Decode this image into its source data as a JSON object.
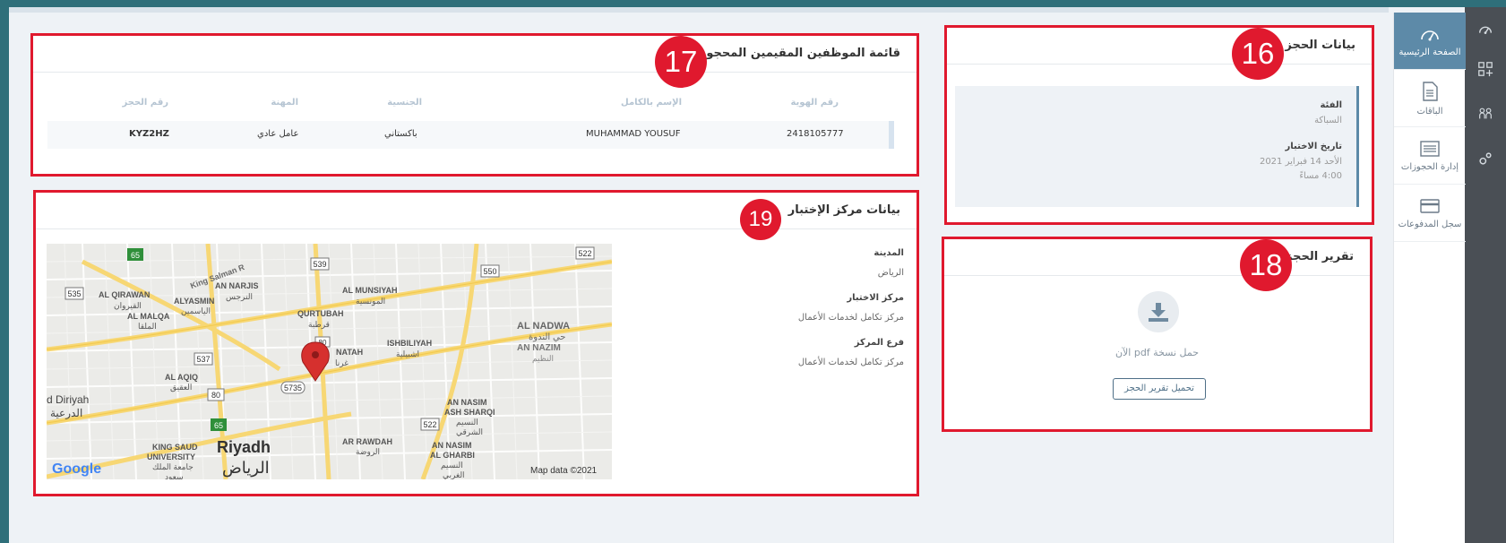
{
  "sidebar": {
    "items": [
      {
        "label": "الصفحة الرئيسية",
        "icon": "dashboard-icon",
        "active": true
      },
      {
        "label": "الباقات",
        "icon": "document-icon",
        "active": false
      },
      {
        "label": "إدارة الحجوزات",
        "icon": "list-icon",
        "active": false
      },
      {
        "label": "سجل المدفوعات",
        "icon": "card-icon",
        "active": false
      }
    ]
  },
  "rail": {
    "icons": [
      "speedometer-icon",
      "apps-add-icon",
      "people-icon",
      "settings-icon"
    ]
  },
  "booking_details": {
    "badge": "16",
    "title": "بيانات الحجز",
    "category_label": "الفئة",
    "category_value": "السباكة",
    "test_date_label": "تاريخ الاختبار",
    "test_date_value": "الأحد 14 فبراير 2021",
    "test_time_value": "4:00 مساءً"
  },
  "employees": {
    "badge": "17",
    "title": "قائمة الموظفين المقيمين المحجوز لهم",
    "columns": {
      "id": "رقم الهوية",
      "name": "الإسم بالكامل",
      "nationality": "الجنسية",
      "profession": "المهنة",
      "booking": "رقم الحجز"
    },
    "rows": [
      {
        "id": "2418105777",
        "name": "MUHAMMAD YOUSUF",
        "nationality": "باكستاني",
        "profession": "عامل عادي",
        "booking": "KYZ2HZ"
      }
    ]
  },
  "report": {
    "badge": "18",
    "title": "تقرير الحجز",
    "download_text": "حمل نسخة pdf الآن",
    "button_label": "تحميل تقرير الحجز"
  },
  "center": {
    "badge": "19",
    "title": "بيانات مركز الإختبار",
    "city_label": "المدينة",
    "city_value": "الرياض",
    "center_label": "مركز الاختبار",
    "center_value": "مركز تكامل لخدمات الأعمال",
    "branch_label": "فرع المركز",
    "branch_value": "مركز تكامل لخدمات الأعمال"
  },
  "map": {
    "labels": {
      "king_salman": "King Salman R",
      "al_qirawan": "AL QIRAWAN",
      "al_qirawan_ar": "القيروان",
      "an_narjis": "AN NARJIS",
      "an_narjis_ar": "النرجس",
      "alyasmin": "ALYASMIN",
      "alyasmin_ar": "الياسمين",
      "al_malqa": "AL MALQA",
      "al_malqa_ar": "الملقا",
      "al_munsiyah": "AL MUNSIYAH",
      "al_munsiyah_ar": "المونسية",
      "qurtubah": "QURTUBAH",
      "qurtubah_ar": "قرطبة",
      "al_nadwa": "AL NADWA",
      "al_nadwa_ar": "حي الندوة",
      "an_nazim": "AN NAZIM",
      "an_nazim_ar": "النظيم",
      "ishbiliyah": "ISHBILIYAH",
      "ishbiliyah_ar": "اشبيلية",
      "ghirnatah": "NATAH",
      "ghirnatah_ar": "غرنا",
      "al_aqiq": "AL AQIQ",
      "al_aqiq_ar": "العقيق",
      "diriyah": "d Diriyah",
      "diriyah_ar": "الدرعية",
      "an_nasim_sharqi": "AN NASIM",
      "an_nasim_sharqi_2": "ASH SHARQI",
      "an_nasim_sharqi_ar": "النسيم",
      "an_nasim_sharqi_ar2": "الشرقي",
      "ar_rawdah": "AR RAWDAH",
      "ar_rawdah_ar": "الروضة",
      "an_nasim_gharbi": "AN NASIM",
      "an_nasim_gharbi_2": "AL GHARBI",
      "an_nasim_gharbi_ar": "النسيم",
      "an_nasim_gharbi_ar2": "الغربي",
      "ksu": "KING SAUD",
      "ksu_2": "UNIVERSITY",
      "ksu_ar": "جامعة الملك",
      "ksu_ar2": "سعود",
      "riyadh": "Riyadh",
      "riyadh_ar": "الرياض",
      "google": "Google",
      "copyright": "Map data ©2021"
    },
    "shields": [
      "65",
      "539",
      "522",
      "535",
      "550",
      "537",
      "80",
      "5735",
      "65",
      "522",
      "80"
    ]
  },
  "colors": {
    "accent_red": "#e0192e",
    "sidebar_active": "#5d8aa8",
    "rail": "#4a4f55"
  }
}
